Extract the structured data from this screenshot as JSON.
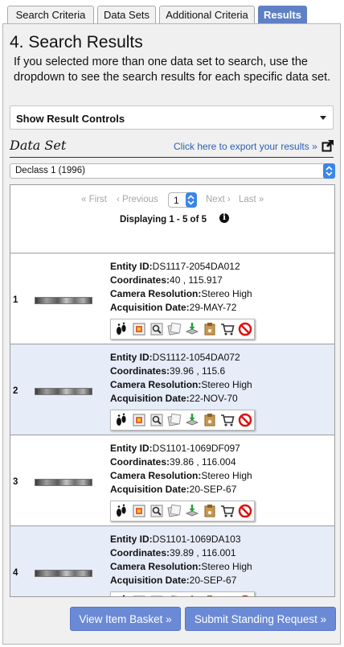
{
  "tabs": [
    {
      "label": "Search Criteria",
      "active": false
    },
    {
      "label": "Data Sets",
      "active": false
    },
    {
      "label": "Additional Criteria",
      "active": false
    },
    {
      "label": "Results",
      "active": true
    }
  ],
  "page": {
    "title": "4. Search Results",
    "intro": "If you selected more than one data set to search, use the dropdown to see the search results for each specific data set."
  },
  "controls": {
    "label": "Show Result Controls"
  },
  "dataset": {
    "label": "Data Set",
    "export_link": "Click here to export your results »",
    "selected": "Declass 1 (1996)"
  },
  "pager": {
    "first": "« First",
    "previous": "‹ Previous",
    "page": "1",
    "next": "Next ›",
    "last": "Last »",
    "displaying": "Displaying 1 - 5 of 5"
  },
  "labels": {
    "entity_id": "Entity ID:",
    "coordinates": "Coordinates:",
    "camera_resolution": "Camera Resolution:",
    "acquisition_date": "Acquisition Date:"
  },
  "results": [
    {
      "num": "1",
      "entity_id": "DS1117-2054DA012",
      "coordinates": "40 , 115.917",
      "camera_resolution": "Stereo High",
      "acquisition_date": "29-MAY-72"
    },
    {
      "num": "2",
      "entity_id": "DS1112-1054DA072",
      "coordinates": "39.96 , 115.6",
      "camera_resolution": "Stereo High",
      "acquisition_date": "22-NOV-70"
    },
    {
      "num": "3",
      "entity_id": "DS1101-1069DF097",
      "coordinates": "39.86 , 116.004",
      "camera_resolution": "Stereo High",
      "acquisition_date": "20-SEP-67"
    },
    {
      "num": "4",
      "entity_id": "DS1101-1069DA103",
      "coordinates": "39.89 , 116.001",
      "camera_resolution": "Stereo High",
      "acquisition_date": "20-SEP-67"
    }
  ],
  "row_icons": [
    "footprint-icon",
    "overlay-icon",
    "metadata-icon",
    "compare-icon",
    "download-icon",
    "order-icon",
    "cart-icon",
    "exclude-icon"
  ],
  "buttons": {
    "view_basket": "View Item Basket »",
    "standing_request": "Submit Standing Request »"
  },
  "colors": {
    "accent": "#6b8ad6",
    "active_tab": "#5f80c4",
    "link": "#2c61b1",
    "alt_row": "#e6ecf8"
  }
}
